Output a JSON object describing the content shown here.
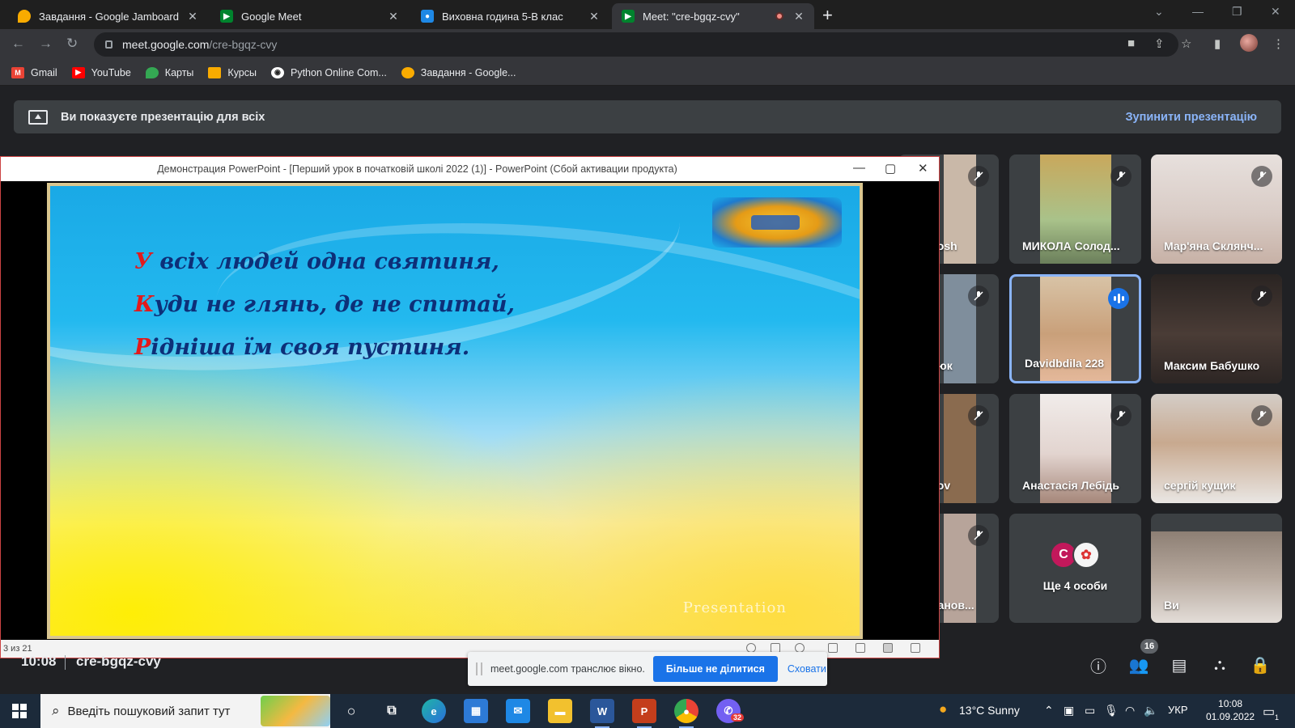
{
  "browser": {
    "tabs": [
      {
        "title": "Завдання - Google Jamboard",
        "active": false,
        "icon": "jamboard-icon"
      },
      {
        "title": "Google Meet",
        "active": false,
        "icon": "meet-icon"
      },
      {
        "title": "Виховна година 5-В клас",
        "active": false,
        "icon": "classroom-icon"
      },
      {
        "title": "Meet: \"cre-bgqz-cvy\"",
        "active": true,
        "icon": "meet-icon",
        "recording": true
      }
    ],
    "url_host": "meet.google.com",
    "url_path": "/cre-bgqz-cvy",
    "bookmarks": [
      {
        "label": "Gmail",
        "icon": "gmail-icon",
        "color": "#ea4335"
      },
      {
        "label": "YouTube",
        "icon": "youtube-icon",
        "color": "#ff0000"
      },
      {
        "label": "Карты",
        "icon": "maps-icon",
        "color": "#34a853"
      },
      {
        "label": "Курсы",
        "icon": "classroom-icon",
        "color": "#f9ab00"
      },
      {
        "label": "Python Online Com...",
        "icon": "python-icon",
        "color": "#3c4043"
      },
      {
        "label": "Завдання - Google...",
        "icon": "jamboard-icon",
        "color": "#f9ab00"
      }
    ]
  },
  "banner": {
    "message": "Ви показуєте презентацію для всіх",
    "stop_label": "Зупинити презентацію"
  },
  "powerpoint": {
    "title": "Демонстрация PowerPoint - [Перший урок в початковій школі 2022 (1)] - PowerPoint (Сбой активации продукта)",
    "status": "3 из 21",
    "verse": [
      {
        "cap": "У",
        "rest": " всіх людей одна святиня,"
      },
      {
        "cap": "К",
        "rest": "уди не глянь, де не спитай,"
      },
      {
        "cap": "Р",
        "rest": "ідніша їм своя пустиня."
      }
    ],
    "watermark": "Presentation"
  },
  "participants": [
    {
      "name": "vosh",
      "muted": true,
      "cam_color": "#c9b8a8"
    },
    {
      "name": "МИКОЛА Солод...",
      "muted": true,
      "cam_color": "#b9a37a"
    },
    {
      "name": "Мар'яна Склянч...",
      "muted": true,
      "cam_color": "#d8c9c4"
    },
    {
      "name": "сюк",
      "muted": true,
      "cam_color": "#7f8e9c"
    },
    {
      "name": "Davidbdila 228",
      "muted": false,
      "speaking": true,
      "cam_color": "#c7a58a"
    },
    {
      "name": "Максим Бабушко",
      "muted": true,
      "cam_color": "#3a3230"
    },
    {
      "name": "kov",
      "muted": true,
      "cam_color": "#8a6b4f"
    },
    {
      "name": "Анастасія Лебідь",
      "muted": true,
      "cam_color": "#e9e4e2"
    },
    {
      "name": "сергій кущик",
      "muted": true,
      "cam_color": "#cfc8c2"
    },
    {
      "name": "ранов...",
      "muted": true,
      "cam_color": "#b7a49a"
    },
    {
      "name": "Ще 4 особи",
      "muted": false,
      "avatar_letter": "C",
      "avatar_color": "#c2185b"
    },
    {
      "name": "Ви",
      "muted": false,
      "cam_color": "#a49a92"
    }
  ],
  "meet_bar": {
    "time": "10:08",
    "code": "cre-bgqz-cvy",
    "people_count": "16"
  },
  "share_notice": {
    "text": "meet.google.com транслює вікно.",
    "stop_label": "Більше не ділитися",
    "hide_label": "Сховати"
  },
  "taskbar": {
    "search_placeholder": "Введіть пошуковий запит тут",
    "weather": "13°C  Sunny",
    "lang": "УКР",
    "time": "10:08",
    "date": "01.09.2022",
    "viber_badge": "32",
    "notif_count": "1"
  }
}
